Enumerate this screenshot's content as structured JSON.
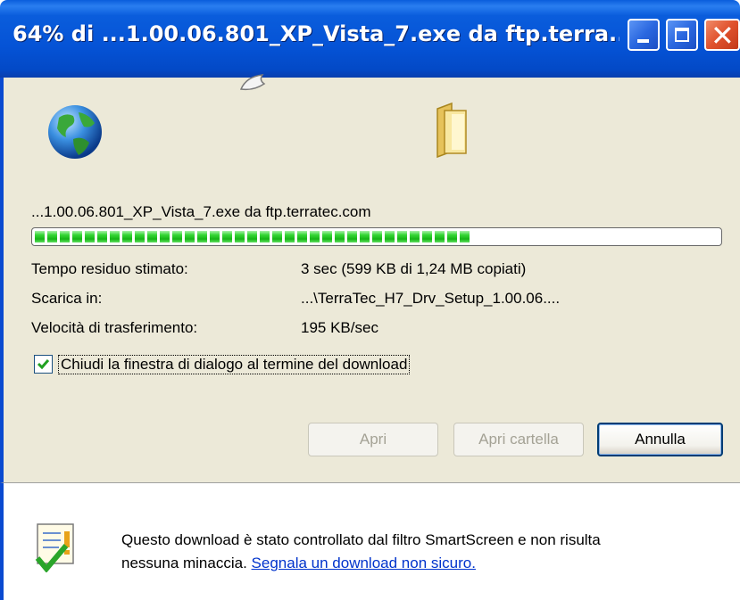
{
  "window": {
    "title": "64% di ...1.00.06.801_XP_Vista_7.exe da ftp.terra...",
    "progress_percent": 64
  },
  "file": {
    "source_line": "...1.00.06.801_XP_Vista_7.exe da ftp.terratec.com"
  },
  "details": {
    "time_label": "Tempo residuo stimato:",
    "time_value": "3 sec (599 KB di 1,24 MB copiati)",
    "dest_label": "Scarica in:",
    "dest_value": "...\\TerraTec_H7_Drv_Setup_1.00.06....",
    "speed_label": "Velocità di trasferimento:",
    "speed_value": "195 KB/sec"
  },
  "option": {
    "close_on_complete_label": "Chiudi la finestra di dialogo al termine del download",
    "checked": true
  },
  "buttons": {
    "open": "Apri",
    "open_folder": "Apri cartella",
    "cancel": "Annulla"
  },
  "smartscreen": {
    "message": "Questo download è stato controllato dal filtro SmartScreen e non risulta",
    "message_line2": "nessuna minaccia.",
    "report_link": "Segnala un download non sicuro."
  },
  "icons": [
    "globe-icon",
    "paper-flying-icon",
    "folder-icon",
    "smartscreen-shield-icon",
    "minimize-icon",
    "maximize-icon",
    "close-icon",
    "checkmark-icon"
  ],
  "colors": {
    "titlebar": "#0553d6",
    "progress": "#16b416",
    "link": "#0033cc"
  }
}
